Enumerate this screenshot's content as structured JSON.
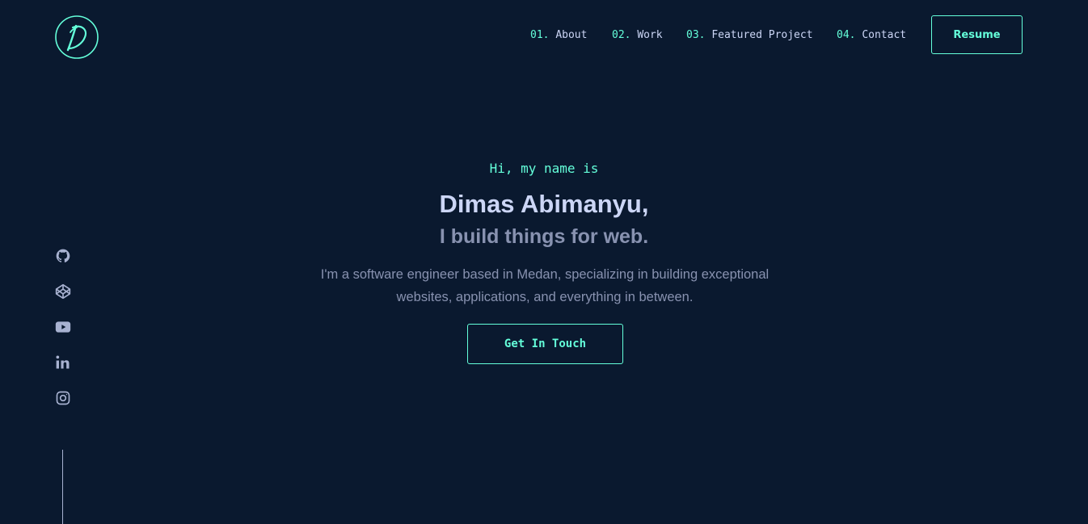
{
  "brand": {
    "logo_icon": "signature-d-logo-icon",
    "accent_color": "#64ffda",
    "background_color": "#0a192f",
    "text_color": "#ccd6f6",
    "muted_color": "#8892b0"
  },
  "nav": {
    "items": [
      {
        "number": "01.",
        "label": "About"
      },
      {
        "number": "02.",
        "label": "Work"
      },
      {
        "number": "03.",
        "label": "Featured Project"
      },
      {
        "number": "04.",
        "label": "Contact"
      }
    ],
    "resume_label": "Resume"
  },
  "hero": {
    "greeting": "Hi, my name is",
    "name": "Dimas Abimanyu,",
    "tagline": "I build things for web.",
    "description": "I'm a software engineer based in Medan, specializing in building exceptional websites, applications, and everything in between.",
    "cta_label": "Get In Touch"
  },
  "social": {
    "icons": [
      "github-icon",
      "codepen-icon",
      "youtube-icon",
      "linkedin-icon",
      "instagram-icon"
    ]
  }
}
